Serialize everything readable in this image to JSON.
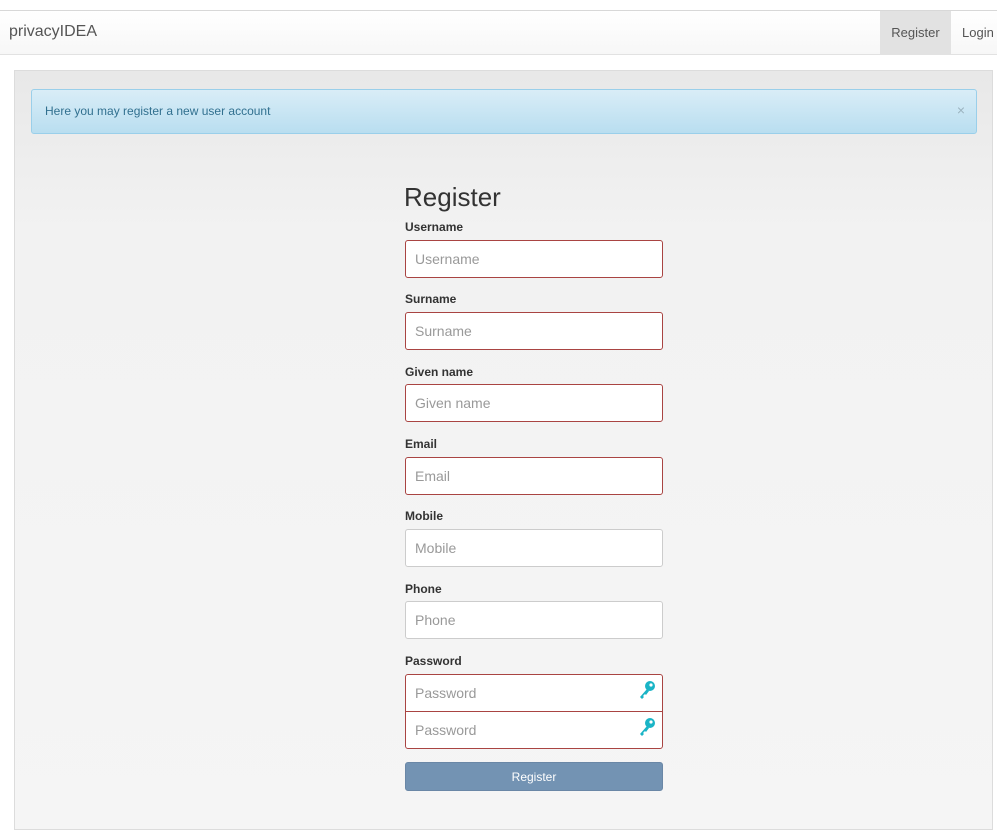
{
  "navbar": {
    "brand": "privacyIDEA",
    "register": "Register",
    "login": "Login"
  },
  "alert": {
    "message": "Here you may register a new user account",
    "close": "×"
  },
  "form": {
    "title": "Register",
    "username": {
      "label": "Username",
      "placeholder": "Username",
      "value": ""
    },
    "surname": {
      "label": "Surname",
      "placeholder": "Surname",
      "value": ""
    },
    "givenname": {
      "label": "Given name",
      "placeholder": "Given name",
      "value": ""
    },
    "email": {
      "label": "Email",
      "placeholder": "Email",
      "value": ""
    },
    "mobile": {
      "label": "Mobile",
      "placeholder": "Mobile",
      "value": ""
    },
    "phone": {
      "label": "Phone",
      "placeholder": "Phone",
      "value": ""
    },
    "password": {
      "label": "Password",
      "placeholder": "Password",
      "confirm_placeholder": "Password",
      "value": ""
    },
    "submit": "Register"
  },
  "icons": {
    "password": "key-icon",
    "close": "close-icon"
  },
  "colors": {
    "invalid": "#a94442",
    "button": "#7393b3",
    "key": "#1ab4c6",
    "alert_text": "#31708f"
  }
}
